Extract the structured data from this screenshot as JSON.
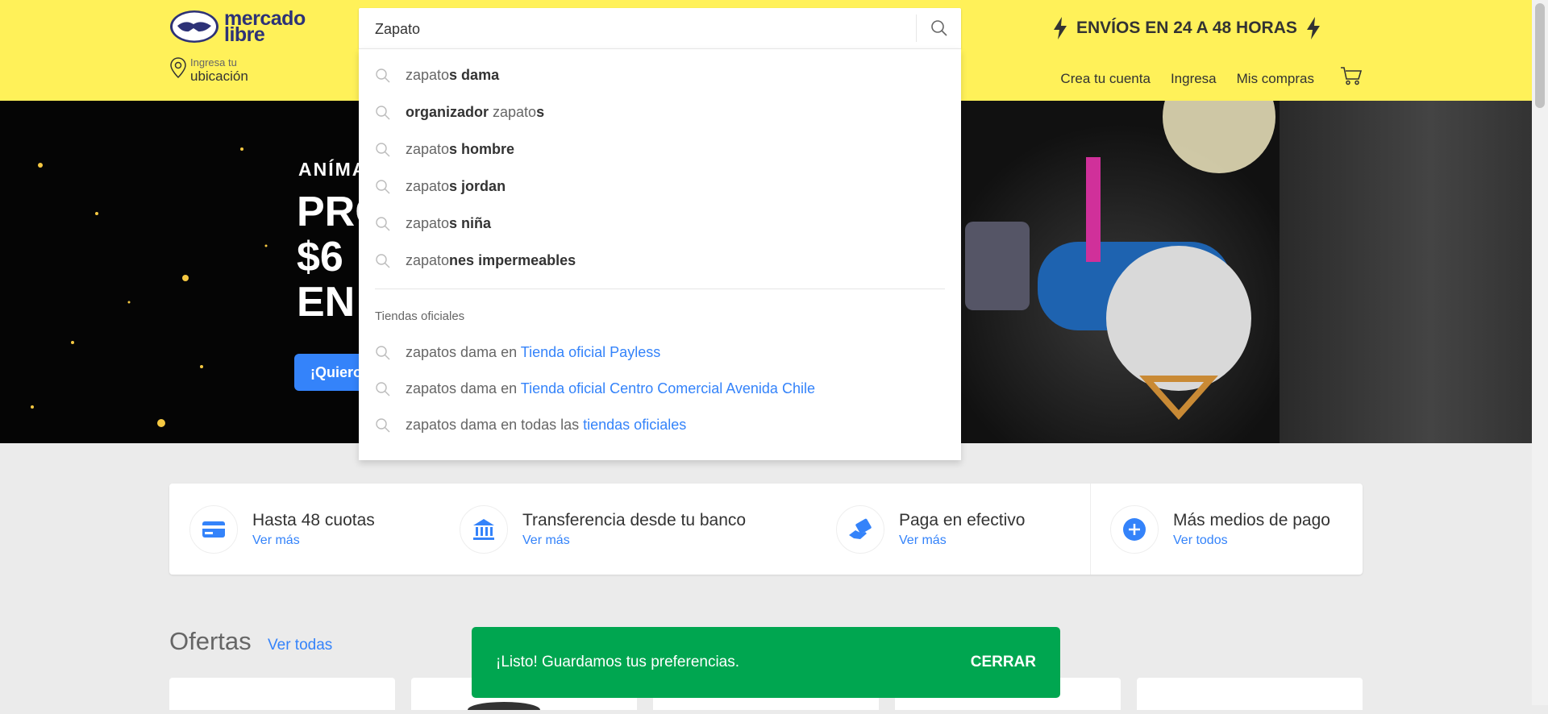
{
  "header": {
    "logo_line1": "mercado",
    "logo_line2": "libre",
    "location_small": "Ingresa tu",
    "location_big": "ubicación",
    "shipping_text": "ENVÍOS EN 24 A 48 HORAS",
    "nav": [
      "Crea tu cuenta",
      "Ingresa",
      "Mis compras"
    ]
  },
  "search": {
    "value": "Zapato",
    "suggestions": [
      {
        "typed": "zapato",
        "rest": "s dama"
      },
      {
        "typed": "",
        "bold_pre": "organizador ",
        "typed2": "zapato",
        "rest": "s"
      },
      {
        "typed": "zapato",
        "rest": "s hombre"
      },
      {
        "typed": "zapato",
        "rest": "s jordan"
      },
      {
        "typed": "zapato",
        "rest": "s niña"
      },
      {
        "typed": "zapato",
        "rest": "nes impermeables"
      }
    ],
    "stores_label": "Tiendas oficiales",
    "stores": [
      {
        "pre": "zapatos dama en ",
        "link": "Tienda oficial Payless"
      },
      {
        "pre": "zapatos dama en ",
        "link": "Tienda oficial Centro Comercial Avenida Chile"
      },
      {
        "pre": "zapatos dama en todas las ",
        "link": "tiendas oficiales"
      }
    ]
  },
  "banner": {
    "text1": "ANÍMA",
    "text2a": "PRO",
    "text2b": "$6",
    "text2c": "EN",
    "button": "¡Quiero"
  },
  "payments": [
    {
      "title": "Hasta 48 cuotas",
      "link": "Ver más"
    },
    {
      "title": "Transferencia desde tu banco",
      "link": "Ver más"
    },
    {
      "title": "Paga en efectivo",
      "link": "Ver más"
    },
    {
      "title": "Más medios de pago",
      "link": "Ver todos"
    }
  ],
  "offers": {
    "title": "Ofertas",
    "link": "Ver todas"
  },
  "toast": {
    "message": "¡Listo! Guardamos tus preferencias.",
    "button": "CERRAR"
  },
  "colors": {
    "header_bg": "#fff159",
    "accent_blue": "#3483fa",
    "toast_green": "#00a650"
  }
}
